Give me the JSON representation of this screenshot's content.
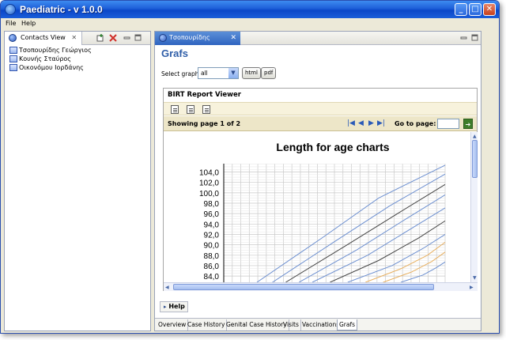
{
  "window": {
    "title": "Paediatric - v 1.0.0",
    "minimize_glyph": "_",
    "maximize_glyph": "□",
    "close_glyph": "✕"
  },
  "menu": [
    "File",
    "Help"
  ],
  "contacts_view": {
    "tab_label": "Contacts View",
    "close_glyph": "✕",
    "contacts": [
      "Τσοπουρίδης Γεώργιος",
      "Κουνής Σταύρος",
      "Οικονόμου Ιορδάνης"
    ]
  },
  "editor": {
    "tab_label": "Τσοπουρίδης Γεώργιος",
    "close_glyph": "✕",
    "heading": "Grafs",
    "select_label": "Select graph",
    "select_value": "all",
    "html_button": "html",
    "pdf_button": "pdf"
  },
  "birt": {
    "title": "BIRT Report Viewer",
    "showing_text": "Showing page  1  of  2",
    "goto_label": "Go to page:",
    "goto_value": "",
    "goto_glyph": "➔"
  },
  "chart_data": {
    "type": "line",
    "title": "Length for age charts",
    "xlabel": "",
    "ylabel": "",
    "ylim": [
      82.8,
      105.6
    ],
    "yticks": [
      "104,0",
      "102,0",
      "100,0",
      "98,0",
      "96,0",
      "94,0",
      "92,0",
      "90,0",
      "88,0",
      "86,0",
      "84,0"
    ],
    "grid": true,
    "x_grid_lines": 26,
    "series": [
      {
        "color": "#6c8fd0",
        "values": [
          [
            0.15,
            82.8
          ],
          [
            0.45,
            91.5
          ],
          [
            0.7,
            99.0
          ],
          [
            1.0,
            105.3
          ]
        ]
      },
      {
        "color": "#6c8fd0",
        "values": [
          [
            0.22,
            82.8
          ],
          [
            0.5,
            90.6
          ],
          [
            0.75,
            97.5
          ],
          [
            1.0,
            103.6
          ]
        ]
      },
      {
        "color": "#444444",
        "values": [
          [
            0.28,
            82.8
          ],
          [
            0.55,
            89.8
          ],
          [
            0.8,
            96.4
          ],
          [
            1.0,
            101.6
          ]
        ]
      },
      {
        "color": "#6c8fd0",
        "values": [
          [
            0.34,
            82.8
          ],
          [
            0.6,
            89.0
          ],
          [
            0.82,
            94.9
          ],
          [
            1.0,
            99.6
          ]
        ]
      },
      {
        "color": "#6c8fd0",
        "values": [
          [
            0.4,
            82.8
          ],
          [
            0.65,
            88.0
          ],
          [
            0.85,
            93.2
          ],
          [
            1.0,
            97.1
          ]
        ]
      },
      {
        "color": "#444444",
        "values": [
          [
            0.48,
            82.8
          ],
          [
            0.7,
            87.0
          ],
          [
            0.88,
            91.3
          ],
          [
            1.0,
            94.6
          ]
        ]
      },
      {
        "color": "#6c8fd0",
        "values": [
          [
            0.56,
            82.8
          ],
          [
            0.76,
            86.0
          ],
          [
            0.9,
            89.3
          ],
          [
            1.0,
            92.0
          ]
        ]
      },
      {
        "color": "#e8b060",
        "values": [
          [
            0.64,
            82.8
          ],
          [
            0.8,
            85.4
          ],
          [
            0.92,
            88.0
          ],
          [
            1.0,
            90.5
          ]
        ]
      },
      {
        "color": "#e8b060",
        "values": [
          [
            0.72,
            82.8
          ],
          [
            0.85,
            84.8
          ],
          [
            0.94,
            86.8
          ],
          [
            1.0,
            88.6
          ]
        ]
      },
      {
        "color": "#6c8fd0",
        "values": [
          [
            0.8,
            82.8
          ],
          [
            0.9,
            84.2
          ],
          [
            0.96,
            85.6
          ],
          [
            1.0,
            86.7
          ]
        ]
      }
    ]
  },
  "help_label": "Help",
  "bottom_tabs": [
    {
      "label": "Overview"
    },
    {
      "label": "Case History"
    },
    {
      "label": "Genital Case History"
    },
    {
      "label": "Visits"
    },
    {
      "label": "Vaccinations"
    },
    {
      "label": "Grafs",
      "active": true
    }
  ]
}
